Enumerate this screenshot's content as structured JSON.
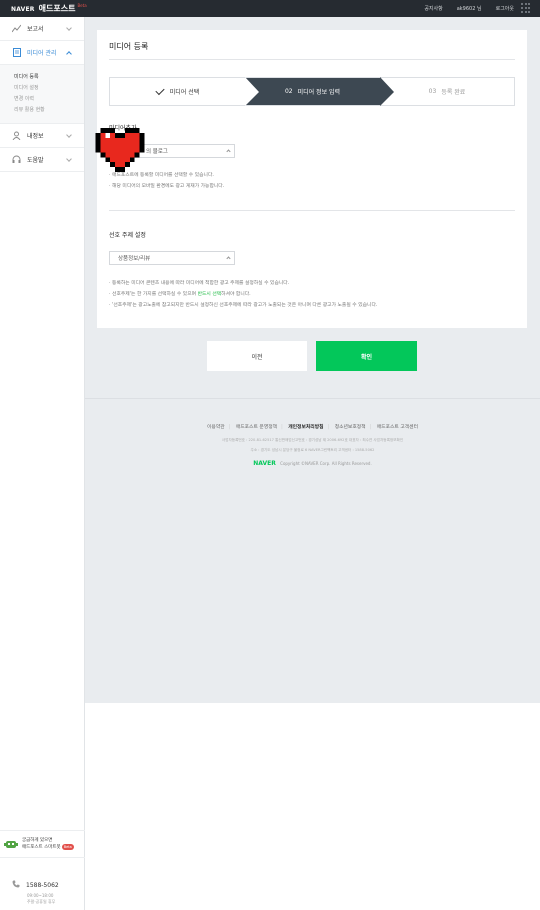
{
  "header": {
    "brand_naver": "NAVER",
    "brand_name": "애드포스트",
    "brand_beta": "Beta",
    "nav": [
      "공지사항",
      "ak9602 님",
      "로그아웃"
    ]
  },
  "sidebar": {
    "items": [
      {
        "label": "보고서",
        "icon": "chart-line-icon"
      },
      {
        "label": "미디어 관리",
        "icon": "document-icon"
      },
      {
        "label": "내정보",
        "icon": "user-icon"
      },
      {
        "label": "도움말",
        "icon": "headset-icon"
      }
    ],
    "submenu": [
      "미디어 등록",
      "미디어 설정",
      "변경 이력",
      "리뷰 활용 현황"
    ],
    "help_banner_line1": "궁금하게 있으면",
    "help_banner_line2": "애드포스트 스마트봇",
    "help_banner_beta": "Beta",
    "phone": "1588-5062",
    "phone_hours": "09:00~18:00",
    "phone_note": "주말·공휴일 휴무"
  },
  "main": {
    "title": "미디어 등록",
    "steps": [
      {
        "num": "",
        "label": "미디어 선택"
      },
      {
        "num": "02",
        "label": "미디어 정보 입력"
      },
      {
        "num": "03",
        "label": "등록 완료"
      }
    ],
    "media_section_label": "미디어추가",
    "media_select_value": "의 블로그",
    "media_notes": [
      "· 애드포스트에 등록할 미디어를 선택할 수 있습니다.",
      "· 해당 미디어의 모바일 환경에도 광고 게재가 가능합니다."
    ],
    "topic_section_label": "선호 주제 설정",
    "topic_select_value": "상품정보/리뷰",
    "topic_notes": [
      "· 등록하는 미디어 콘텐츠 내용에 따라 미디어에 적합한 광고 주제를 설정하실 수 있습니다.",
      "· 선호주제'는 한 가지를 선택하실 수 있으며",
      "반드시 선택",
      "하셔야 합니다.",
      "· '선호주제'는 광고노출에 참고되지만 반드시 설정하신 선호주제에 따라 광고가 노출되는 것은 아니며 다른 광고가 노출될 수 있습니다."
    ],
    "btn_prev": "이전",
    "btn_ok": "확인"
  },
  "footer": {
    "links": [
      "이용약관",
      "애드포스트 운영정책",
      "개인정보처리방침",
      "청소년보호정책",
      "애드포스트 고객센터"
    ],
    "info1": "사업자등록번호 : 220-81-62517   통신판매업신고번호 : 경기성남 제 2006-692호   대표자 : 최수연   사업자등록정보확인",
    "info2": "주소 : 경기도 성남시 분당구 불정로 6 NAVER그린팩토리   고객센터 : 1588-5062",
    "copy_brand": "NAVER",
    "copy": "Copyright ©NAVER Corp. All Rights Reserved."
  },
  "colors": {
    "accent": "#3a8bd6",
    "green": "#03c75a",
    "dark_step": "#3d4852",
    "topbar": "#262b31"
  }
}
